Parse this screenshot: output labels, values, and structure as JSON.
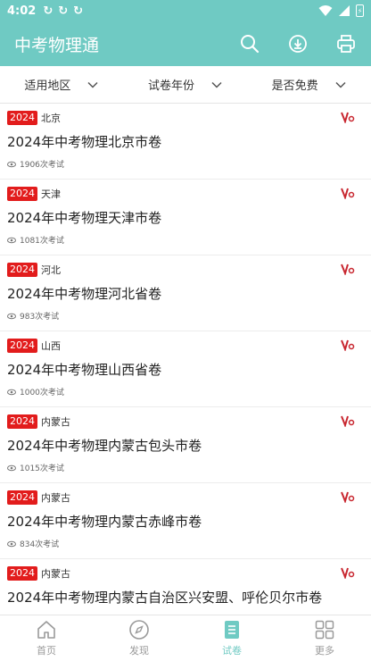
{
  "status": {
    "time": "4:02",
    "sync1": "↻",
    "sync2": "↻",
    "sync3": "↻",
    "battery": "⚡"
  },
  "app": {
    "title": "中考物理通"
  },
  "filters": [
    "适用地区",
    "试卷年份",
    "是否免费"
  ],
  "items": [
    {
      "year": "2024",
      "region": "北京",
      "title": "2024年中考物理北京市卷",
      "views": "1906次考试"
    },
    {
      "year": "2024",
      "region": "天津",
      "title": "2024年中考物理天津市卷",
      "views": "1081次考试"
    },
    {
      "year": "2024",
      "region": "河北",
      "title": "2024年中考物理河北省卷",
      "views": "983次考试"
    },
    {
      "year": "2024",
      "region": "山西",
      "title": "2024年中考物理山西省卷",
      "views": "1000次考试"
    },
    {
      "year": "2024",
      "region": "内蒙古",
      "title": "2024年中考物理内蒙古包头市卷",
      "views": "1015次考试"
    },
    {
      "year": "2024",
      "region": "内蒙古",
      "title": "2024年中考物理内蒙古赤峰市卷",
      "views": "834次考试"
    },
    {
      "year": "2024",
      "region": "内蒙古",
      "title": "2024年中考物理内蒙古自治区兴安盟、呼伦贝尔市卷",
      "views": ""
    }
  ],
  "tabs": [
    {
      "label": "首页",
      "icon": "home-icon",
      "active": false
    },
    {
      "label": "发现",
      "icon": "compass-icon",
      "active": false
    },
    {
      "label": "试卷",
      "icon": "paper-icon",
      "active": true
    },
    {
      "label": "更多",
      "icon": "grid-icon",
      "active": false
    }
  ],
  "colors": {
    "accent": "#6fcac3",
    "tag": "#e21c1c",
    "vip": "#c8262f"
  }
}
